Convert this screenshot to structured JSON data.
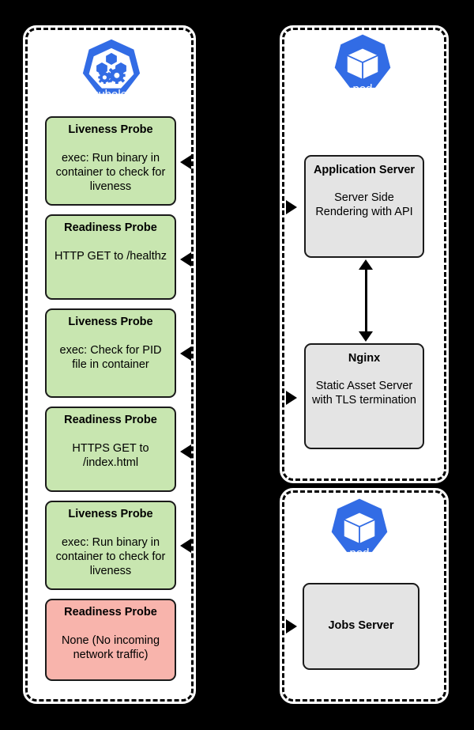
{
  "colors": {
    "background": "#000000",
    "panel_fill": "#ffffff",
    "probe_green": "#c8e6b0",
    "probe_red": "#f8b4ac",
    "server_gray": "#e4e4e4",
    "kubernetes_blue": "#326ce5",
    "stroke": "#000000"
  },
  "panels": {
    "kubelet": {
      "name": "kubelet-node-panel"
    },
    "pod_web": {
      "name": "pod-web-panel"
    },
    "pod_jobs": {
      "name": "pod-jobs-panel"
    }
  },
  "logos": {
    "kubelet": {
      "caption": "kubelet",
      "icon": "kubernetes-kubelet-icon"
    },
    "pod_web": {
      "caption": "pod",
      "icon": "kubernetes-pod-icon"
    },
    "pod_jobs": {
      "caption": "pod",
      "icon": "kubernetes-pod-icon"
    }
  },
  "probes": [
    {
      "title": "Liveness Probe",
      "body": "exec:  Run binary in container to check for liveness",
      "status": "green"
    },
    {
      "title": "Readiness Probe",
      "body": "HTTP GET to /healthz",
      "status": "green"
    },
    {
      "title": "Liveness Probe",
      "body": "exec:  Check for PID file in container",
      "status": "green"
    },
    {
      "title": "Readiness Probe",
      "body": "HTTPS GET to /index.html",
      "status": "green"
    },
    {
      "title": "Liveness Probe",
      "body": "exec:  Run binary in container to check for liveness",
      "status": "green"
    },
    {
      "title": "Readiness Probe",
      "body": "None (No incoming network traffic)",
      "status": "red"
    }
  ],
  "servers": [
    {
      "title": "Application Server",
      "body": "Server Side Rendering with API"
    },
    {
      "title": "Nginx",
      "body": "Static Asset Server with TLS termination"
    },
    {
      "title": "Jobs Server",
      "body": ""
    }
  ],
  "arrows": {
    "to_probes": [
      {
        "name": "arrow-to-liveness-probe-1"
      },
      {
        "name": "arrow-to-readiness-probe-1"
      },
      {
        "name": "arrow-to-liveness-probe-2"
      },
      {
        "name": "arrow-to-readiness-probe-2"
      },
      {
        "name": "arrow-to-liveness-probe-3"
      }
    ],
    "to_servers": [
      {
        "name": "arrow-to-application-server"
      },
      {
        "name": "arrow-to-nginx"
      },
      {
        "name": "arrow-to-jobs-server"
      }
    ],
    "bidirectional": [
      {
        "name": "arrow-application-server-to-nginx"
      }
    ]
  }
}
